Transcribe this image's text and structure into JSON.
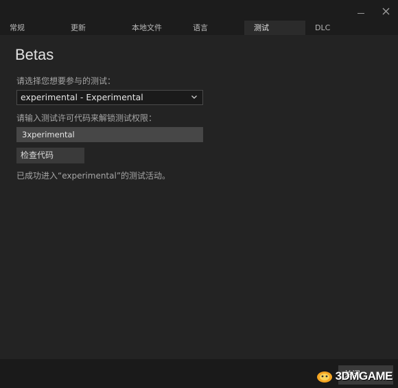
{
  "tabs": [
    {
      "label": "常规",
      "active": false
    },
    {
      "label": "更新",
      "active": false
    },
    {
      "label": "本地文件",
      "active": false
    },
    {
      "label": "语言",
      "active": false
    },
    {
      "label": "测试",
      "active": true
    },
    {
      "label": "DLC",
      "active": false
    }
  ],
  "betas": {
    "title": "Betas",
    "select_label": "请选择您想要参与的测试：",
    "selected_beta": "experimental - Experimental",
    "code_label": "请输入测试许可代码来解锁测试权限：",
    "code_value": "3xperimental",
    "check_button": "检查代码",
    "status_text": "已成功进入“experimental”的测试活动。"
  },
  "footer": {
    "close_button": "关闭"
  },
  "watermark": {
    "text": "3DMGAME"
  },
  "colors": {
    "background": "#1c1c1c",
    "panel": "#232323",
    "active_tab": "#2b2b2b",
    "text": "#c8c8c8"
  }
}
